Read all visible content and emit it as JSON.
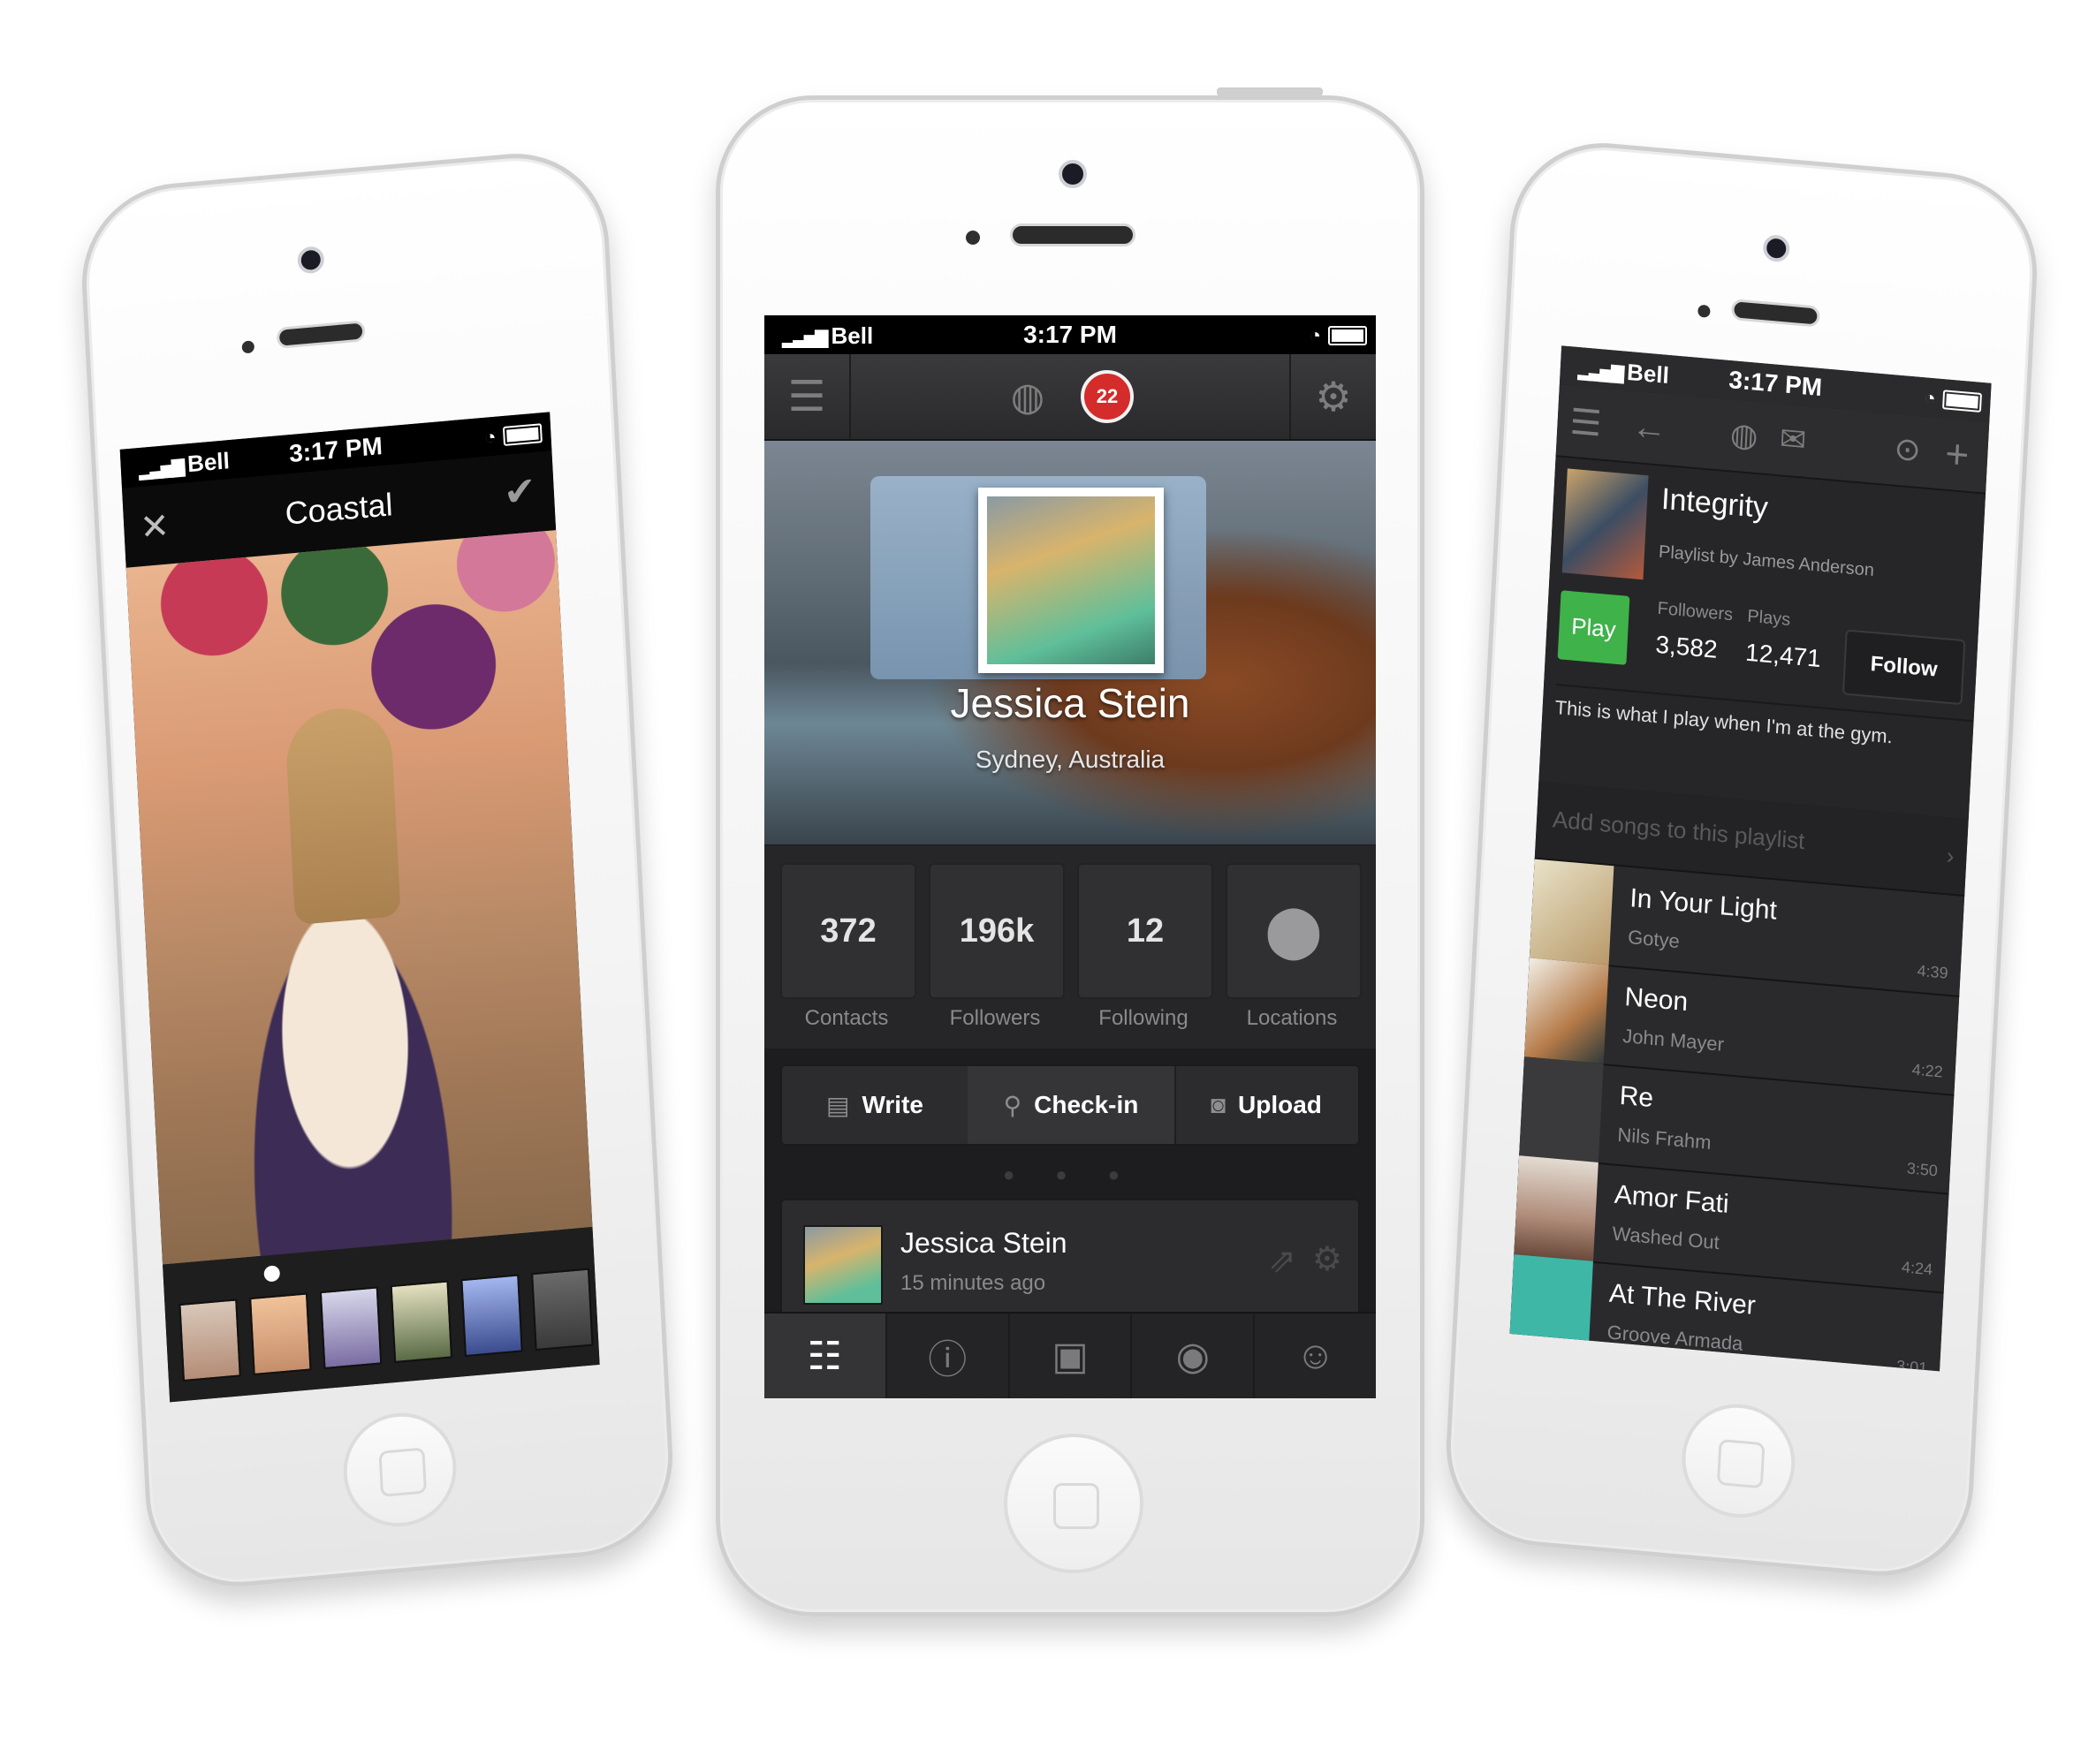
{
  "status": {
    "carrier": "Bell",
    "time": "3:17 PM"
  },
  "left_phone": {
    "title": "Coastal"
  },
  "center_phone": {
    "badge": "22",
    "profile": {
      "name": "Jessica Stein",
      "location": "Sydney, Australia"
    },
    "stats": [
      {
        "value": "372",
        "label": "Contacts"
      },
      {
        "value": "196k",
        "label": "Followers"
      },
      {
        "value": "12",
        "label": "Following"
      },
      {
        "value": "",
        "label": "Locations"
      }
    ],
    "actions": [
      {
        "label": "Write",
        "icon": "document-icon"
      },
      {
        "label": "Check-in",
        "icon": "location-pin-icon"
      },
      {
        "label": "Upload",
        "icon": "camera-icon"
      }
    ],
    "post": {
      "author": "Jessica Stein",
      "time": "15 minutes ago"
    },
    "tabs": [
      "list-icon",
      "info-icon",
      "photo-icon",
      "disc-icon",
      "people-icon"
    ]
  },
  "right_phone": {
    "playlist": {
      "title": "Integrity",
      "subtitle": "Playlist by James Anderson",
      "play_label": "Play",
      "followers_label": "Followers",
      "followers": "3,582",
      "plays_label": "Plays",
      "plays": "12,471",
      "follow_label": "Follow",
      "description": "This is what I play when I'm at the gym.",
      "add_songs": "Add songs to this playlist"
    },
    "tracks": [
      {
        "title": "In Your Light",
        "artist": "Gotye",
        "duration": "4:39"
      },
      {
        "title": "Neon",
        "artist": "John Mayer",
        "duration": "4:22"
      },
      {
        "title": "Re",
        "artist": "Nils Frahm",
        "duration": "3:50"
      },
      {
        "title": "Amor Fati",
        "artist": "Washed Out",
        "duration": "4:24"
      },
      {
        "title": "At The River",
        "artist": "Groove Armada",
        "duration": "3:01"
      }
    ]
  }
}
